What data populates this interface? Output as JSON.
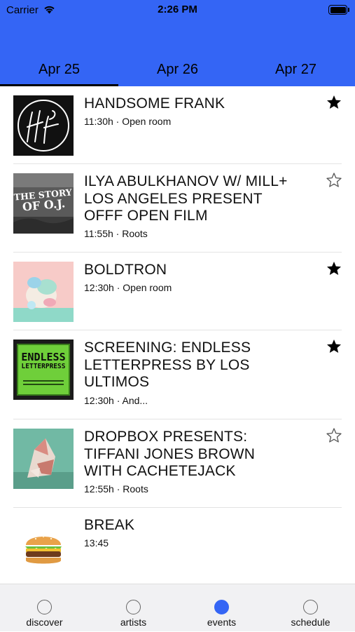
{
  "status_bar": {
    "carrier": "Carrier",
    "time": "2:26 PM"
  },
  "colors": {
    "header": "#3465f5",
    "nav_active": "#3465f5"
  },
  "tabs": [
    {
      "label": "Apr 25",
      "active": true
    },
    {
      "label": "Apr 26",
      "active": false
    },
    {
      "label": "Apr 27",
      "active": false
    }
  ],
  "events": [
    {
      "title": "HANDSOME FRANK",
      "meta": "11:30h · Open room",
      "starred": true,
      "icon": "handsome-frank-logo"
    },
    {
      "title": "ILYA ABULKHANOV W/ MILL+ LOS ANGELES PRESENT OFFF OPEN FILM",
      "meta": "11:55h · Roots",
      "starred": false,
      "icon": "story-of-oj-image",
      "thumb_text_1": "THE STORY",
      "thumb_text_2": "OF O.J."
    },
    {
      "title": "BOLDTRON",
      "meta": "12:30h · Open room",
      "starred": true,
      "icon": "boldtron-image"
    },
    {
      "title": "SCREENING: ENDLESS LETTERPRESS BY LOS ULTIMOS",
      "meta": "12:30h · And...",
      "starred": true,
      "icon": "endless-letterpress-poster",
      "thumb_text_1": "ENDLESS",
      "thumb_text_2": "LETTERPRESS"
    },
    {
      "title": "DROPBOX PRESENTS: TIFFANI JONES BROWN WITH CACHETEJACK",
      "meta": "12:55h · Roots",
      "starred": false,
      "icon": "paper-sculpture-image"
    },
    {
      "title": "BREAK",
      "meta": "13:45",
      "starred": null,
      "icon": "burger-emoji"
    }
  ],
  "bottom_nav": [
    {
      "label": "discover",
      "active": false
    },
    {
      "label": "artists",
      "active": false
    },
    {
      "label": "events",
      "active": true
    },
    {
      "label": "schedule",
      "active": false
    }
  ]
}
